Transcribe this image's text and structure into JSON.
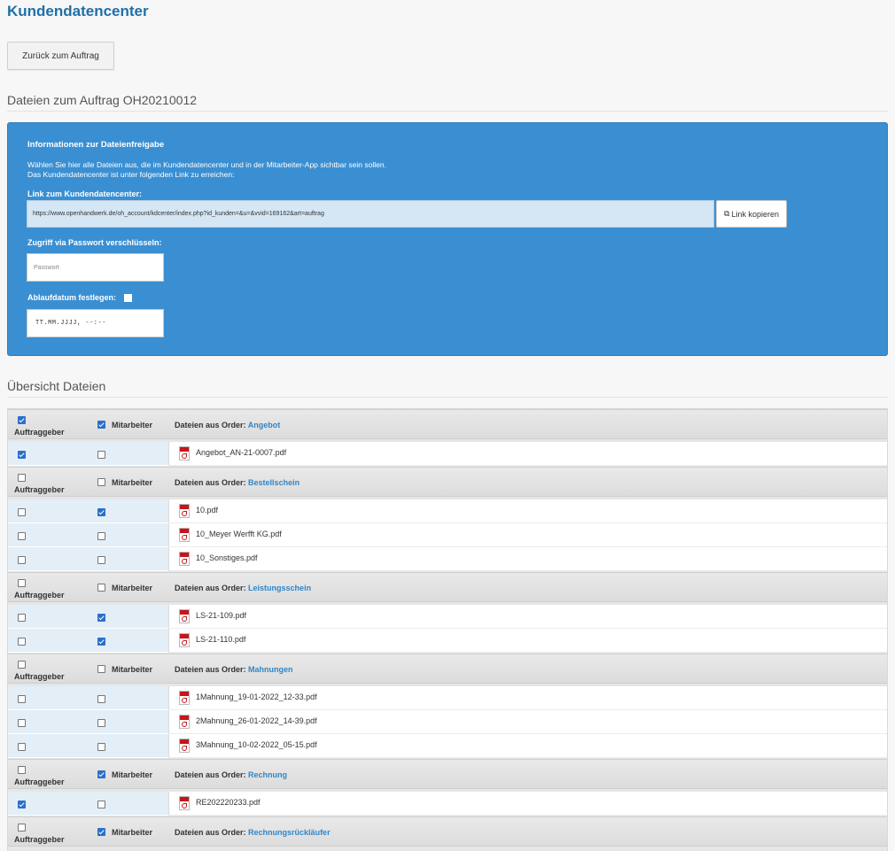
{
  "app": {
    "title": "Kundendatencenter",
    "back_label": "Zurück zum Auftrag"
  },
  "files_section": {
    "title": "Dateien zum Auftrag OH20210012"
  },
  "info": {
    "heading": "Informationen zur Dateienfreigabe",
    "desc_line1": "Wählen Sie hier alle Dateien aus, die im Kundendatencenter und in der Mitarbeiter-App sichtbar sein sollen.",
    "desc_line2": "Das Kundendatencenter ist unter folgenden Link zu erreichen:",
    "link_label": "Link zum Kundendatencenter:",
    "link_value": "https://www.openhandwerk.de/oh_account/kdcenter/index.php?id_kunden=&u=&vvid=169162&art=auftrag",
    "copy_label": "Link kopieren",
    "password_label": "Zugriff via Passwort verschlüsseln:",
    "password_placeholder": "Passwort",
    "expiry_label": "Ablaufdatum festlegen:",
    "expiry_checked": false,
    "date_placeholder": "TT.MM.JJJJ, --:--"
  },
  "overview": {
    "title": "Übersicht Dateien",
    "col_client": "Auftraggeber",
    "col_employee": "Mitarbeiter",
    "group_prefix": "Dateien aus Order:",
    "groups": [
      {
        "name": "Angebot",
        "client": true,
        "employee": true,
        "files": [
          {
            "name": "Angebot_AN-21-0007.pdf",
            "client": true,
            "employee": false
          }
        ]
      },
      {
        "name": "Bestellschein",
        "client": false,
        "employee": false,
        "files": [
          {
            "name": "10.pdf",
            "client": false,
            "employee": true
          },
          {
            "name": "10_Meyer Werfft KG.pdf",
            "client": false,
            "employee": false
          },
          {
            "name": "10_Sonstiges.pdf",
            "client": false,
            "employee": false
          }
        ]
      },
      {
        "name": "Leistungsschein",
        "client": false,
        "employee": false,
        "files": [
          {
            "name": "LS-21-109.pdf",
            "client": false,
            "employee": true
          },
          {
            "name": "LS-21-110.pdf",
            "client": false,
            "employee": true
          }
        ]
      },
      {
        "name": "Mahnungen",
        "client": false,
        "employee": false,
        "files": [
          {
            "name": "1Mahnung_19-01-2022_12-33.pdf",
            "client": false,
            "employee": false
          },
          {
            "name": "2Mahnung_26-01-2022_14-39.pdf",
            "client": false,
            "employee": false
          },
          {
            "name": "3Mahnung_10-02-2022_05-15.pdf",
            "client": false,
            "employee": false
          }
        ]
      },
      {
        "name": "Rechnung",
        "client": false,
        "employee": true,
        "files": [
          {
            "name": "RE202220233.pdf",
            "client": true,
            "employee": false
          }
        ]
      },
      {
        "name": "Rechnungsrückläufer",
        "client": false,
        "employee": true,
        "files": []
      }
    ]
  }
}
